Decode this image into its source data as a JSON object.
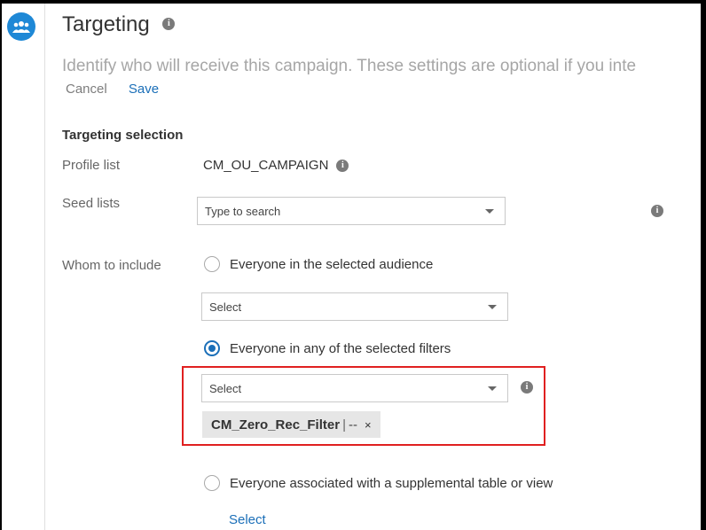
{
  "header": {
    "title": "Targeting",
    "description": "Identify who will receive this campaign. These settings are optional if you inte",
    "cancel_label": "Cancel",
    "save_label": "Save"
  },
  "targeting_selection": {
    "heading": "Targeting selection",
    "profile_list_label": "Profile list",
    "profile_list_value": "CM_OU_CAMPAIGN",
    "seed_lists_label": "Seed lists",
    "seed_lists_placeholder": "Type to search"
  },
  "whom_to_include": {
    "label": "Whom to include",
    "options": [
      {
        "label": "Everyone in the selected audience",
        "checked": false
      },
      {
        "label": "Everyone in any of the selected filters",
        "checked": true
      },
      {
        "label": "Everyone associated with a supplemental table or view",
        "checked": false
      }
    ],
    "audience_select_value": "Select",
    "filters_select_value": "Select",
    "selected_filter": {
      "name": "CM_Zero_Rec_Filter",
      "separator": "|",
      "extra": "--",
      "remove": "×"
    },
    "supplemental_select_link": "Select"
  },
  "colors": {
    "accent": "#1b6fb8",
    "highlight_border": "#e02020",
    "avatar": "#1e88d6"
  },
  "icons": {
    "avatar": "group-icon",
    "info": "info-icon",
    "dropdown": "chevron-down-icon",
    "remove": "close-icon"
  }
}
